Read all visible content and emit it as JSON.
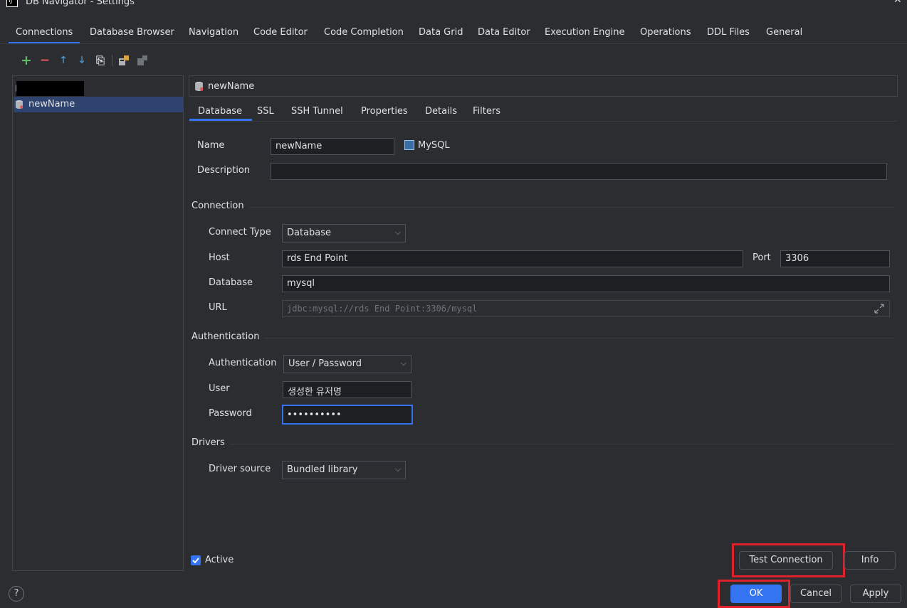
{
  "window": {
    "title": "DB Navigator - Settings",
    "app_icon_text": "IJ",
    "close_glyph": "✕"
  },
  "top_tabs": [
    "Connections",
    "Database Browser",
    "Navigation",
    "Code Editor",
    "Code Completion",
    "Data Grid",
    "Data Editor",
    "Execution Engine",
    "Operations",
    "DDL Files",
    "General"
  ],
  "toolbar": {
    "add": "+",
    "remove": "−",
    "move_up": "🡑",
    "move_down": "🡓",
    "copy": "⎘"
  },
  "tree": {
    "items": [
      {
        "label": ""
      },
      {
        "label": "newName"
      }
    ]
  },
  "connection_header": {
    "name": "newName"
  },
  "inner_tabs": [
    "Database",
    "SSL",
    "SSH Tunnel",
    "Properties",
    "Details",
    "Filters"
  ],
  "form": {
    "name_label": "Name",
    "name_value": "newName",
    "db_type": "MySQL",
    "description_label": "Description",
    "description_value": "",
    "connection_section": "Connection",
    "connect_type_label": "Connect Type",
    "connect_type_value": "Database",
    "host_label": "Host",
    "host_value": "rds End Point",
    "port_label": "Port",
    "port_value": "3306",
    "database_label": "Database",
    "database_value": "mysql",
    "url_label": "URL",
    "url_value": "jdbc:mysql://rds End Point:3306/mysql",
    "auth_section": "Authentication",
    "auth_label": "Authentication",
    "auth_value": "User / Password",
    "user_label": "User",
    "user_value": "생성한 유저명",
    "password_label": "Password",
    "password_value": "••••••••••",
    "drivers_section": "Drivers",
    "driver_source_label": "Driver source",
    "driver_source_value": "Bundled library",
    "active_label": "Active",
    "active_checked": true
  },
  "buttons": {
    "test_connection": "Test Connection",
    "info": "Info",
    "ok": "OK",
    "cancel": "Cancel",
    "apply": "Apply",
    "help": "?"
  },
  "colors": {
    "accent": "#3574f0",
    "highlight_box": "#e0202a",
    "background": "#2b2d30"
  }
}
